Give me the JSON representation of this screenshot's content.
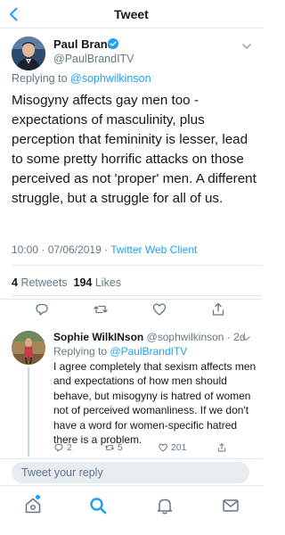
{
  "header": {
    "title": "Tweet",
    "back_icon": "chevron-left-icon"
  },
  "main_tweet": {
    "author_name": "Paul Brand",
    "author_handle": "@PaulBrandITV",
    "verified_icon": "verified-badge-icon",
    "replying_label": "Replying to",
    "replying_to": "@sophwilkinson",
    "text": "Misogyny affects gay men too - expectations of masculinity, plus perception that femininity is lesser, lead to some pretty horrific attacks on those perceived as not 'proper' men. A different struggle, but a struggle for all of us.",
    "time": "10:00",
    "date": "07/06/2019",
    "meta_sep": " · ",
    "client": "Twitter Web Client",
    "retweets_count": "4",
    "retweets_label": "Retweets",
    "likes_count": "194",
    "likes_label": "Likes",
    "actions": [
      "reply-icon",
      "retweet-icon",
      "like-icon",
      "share-icon"
    ]
  },
  "reply_tweet": {
    "author_name": "Sophie WilkINson",
    "author_handle": "@sophwilkinson",
    "time_ago": "2d",
    "replying_label": "Replying to",
    "replying_to": "@PaulBrandITV",
    "text": "I agree completely that sexism affects men and expectations of how men should behave, but misogyny is hatred of women not of perceived womanliness. If we don't have a word for women-specific hatred there is a problem.",
    "reply_count": "2",
    "retweet_count": "5",
    "like_count": "201"
  },
  "composer": {
    "placeholder": "Tweet your reply"
  },
  "tabbar": {
    "tabs": [
      "home-icon",
      "search-icon",
      "notifications-icon",
      "messages-icon"
    ],
    "active_tab": "search",
    "accent_color": "#1da1f2"
  },
  "colors": {
    "accent": "#1da1f2",
    "text": "#14171a",
    "secondary": "#657786",
    "divider": "#e1e8ed"
  }
}
